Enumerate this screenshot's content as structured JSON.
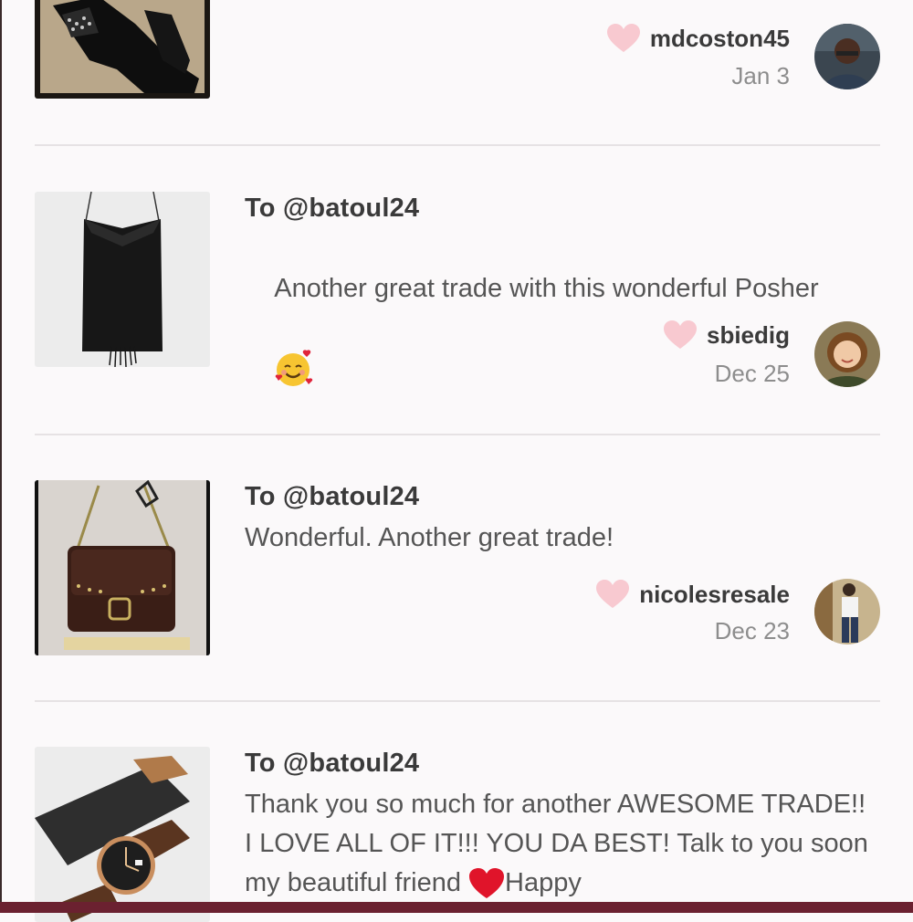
{
  "feed": {
    "items": [
      {
        "to": "",
        "message": "",
        "username": "mdcoston45",
        "date": "Jan 3",
        "thumb_icon": "black-studded-boots-image",
        "avatar_icon": "user-avatar"
      },
      {
        "to": "To @batoul24",
        "message": "Another great trade with this wonderful Posher",
        "username": "sbiedig",
        "date": "Dec 25",
        "thumb_icon": "black-fringe-dress-image",
        "avatar_icon": "user-avatar"
      },
      {
        "to": "To @batoul24",
        "message": "Wonderful. Another great trade!",
        "username": "nicolesresale",
        "date": "Dec 23",
        "thumb_icon": "brown-suede-bag-image",
        "avatar_icon": "user-avatar"
      },
      {
        "to": "To @batoul24",
        "message": "Thank you so much for another AWESOME TRADE!! I LOVE ALL OF IT!!! YOU DA BEST! Talk to you soon my beautiful friend",
        "message_tail": "Happy",
        "username": "",
        "date": "",
        "thumb_icon": "watch-and-case-image",
        "avatar_icon": ""
      }
    ]
  },
  "colors": {
    "background": "#fbf9fa",
    "heart": "#f8c9d0",
    "bottom_bar": "#6b2130",
    "text_primary": "#3a3a3a",
    "text_secondary": "#8d8d8d"
  }
}
